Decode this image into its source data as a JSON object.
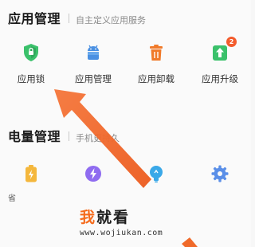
{
  "app_management": {
    "title": "应用管理",
    "subtitle": "自主定义应用服务",
    "items": [
      {
        "label": "应用锁",
        "icon": "shield-lock-icon",
        "color": "#3bc16b"
      },
      {
        "label": "应用管理",
        "icon": "android-icon",
        "color": "#4a90e2"
      },
      {
        "label": "应用卸载",
        "icon": "trash-icon",
        "color": "#f07a2a"
      },
      {
        "label": "应用升级",
        "icon": "upgrade-arrow-icon",
        "color": "#3bc16b",
        "badge": "2"
      }
    ]
  },
  "power_management": {
    "title": "电量管理",
    "subtitle": "手机更持久",
    "items": [
      {
        "icon": "battery-icon",
        "color": "#f4b73c"
      },
      {
        "icon": "lightning-icon",
        "color": "#8f6cf0"
      },
      {
        "icon": "bulb-icon",
        "color": "#3aa8e8"
      },
      {
        "icon": "gear-icon",
        "color": "#5a8fe8"
      }
    ],
    "stray_text": "省"
  },
  "annotation": {
    "arrow_color": "#f06a2a"
  },
  "watermark": {
    "brand_part1": "我",
    "brand_part2": "就看",
    "url": "www.wojiukan.com"
  }
}
